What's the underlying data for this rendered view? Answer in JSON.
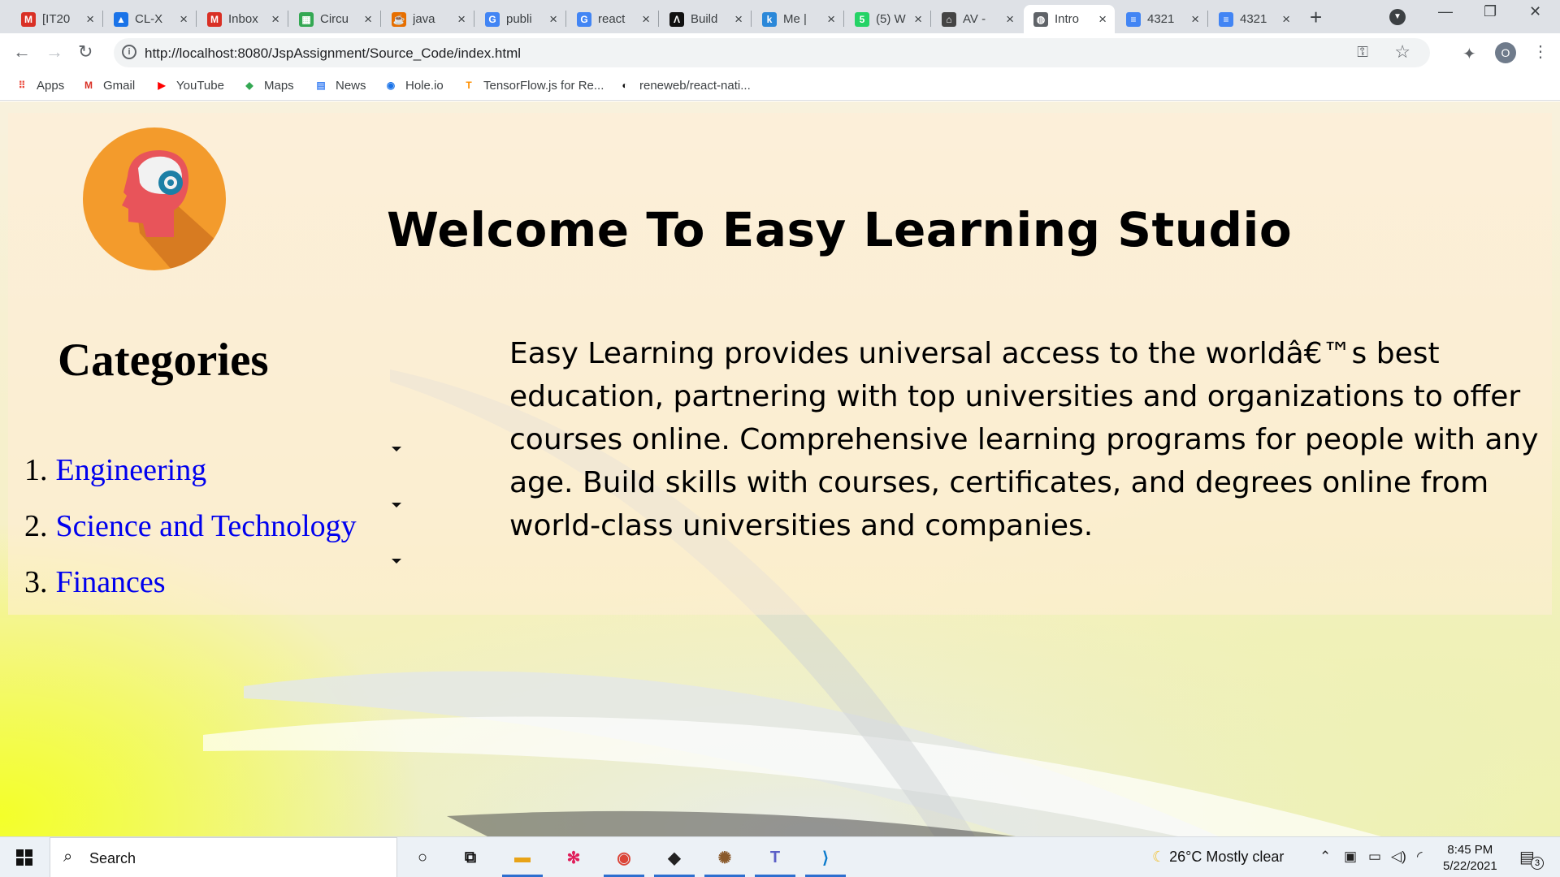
{
  "browser": {
    "tabs": [
      {
        "title": "[IT20",
        "icon": "gmail-icon",
        "color": "#d93025",
        "glyph": "M"
      },
      {
        "title": "CL-X",
        "icon": "drive-icon",
        "color": "#1a73e8",
        "glyph": "▲"
      },
      {
        "title": "Inbox",
        "icon": "gmail-icon",
        "color": "#d93025",
        "glyph": "M"
      },
      {
        "title": "Circu",
        "icon": "grid-icon",
        "color": "#34a853",
        "glyph": "▦"
      },
      {
        "title": "java",
        "icon": "java-icon",
        "color": "#e76f00",
        "glyph": "☕"
      },
      {
        "title": "publi",
        "icon": "google-icon",
        "color": "#4285f4",
        "glyph": "G"
      },
      {
        "title": "react",
        "icon": "google-icon",
        "color": "#4285f4",
        "glyph": "G"
      },
      {
        "title": "Build",
        "icon": "build-icon",
        "color": "#111111",
        "glyph": "Λ"
      },
      {
        "title": "Me |",
        "icon": "k-icon",
        "color": "#2b88d9",
        "glyph": "k"
      },
      {
        "title": "(5) W",
        "icon": "whatsapp-icon",
        "color": "#25d366",
        "glyph": "5"
      },
      {
        "title": "AV -",
        "icon": "academy-icon",
        "color": "#444444",
        "glyph": "⌂"
      },
      {
        "title": "Intro",
        "icon": "globe-icon",
        "color": "#5f6368",
        "glyph": "◍"
      },
      {
        "title": "4321",
        "icon": "docs-icon",
        "color": "#4285f4",
        "glyph": "≡"
      },
      {
        "title": "4321",
        "icon": "docs-icon",
        "color": "#4285f4",
        "glyph": "≡"
      }
    ],
    "url": "http://localhost:8080/JspAssignment/Source_Code/index.html",
    "profile_initial": "O",
    "bookmarks": [
      {
        "label": "Apps",
        "icon": "apps-icon",
        "color": "#ea4335",
        "glyph": "⠿"
      },
      {
        "label": "Gmail",
        "icon": "gmail-icon",
        "color": "#d93025",
        "glyph": "M"
      },
      {
        "label": "YouTube",
        "icon": "youtube-icon",
        "color": "#ff0000",
        "glyph": "▶"
      },
      {
        "label": "Maps",
        "icon": "maps-icon",
        "color": "#34a853",
        "glyph": "◆"
      },
      {
        "label": "News",
        "icon": "news-icon",
        "color": "#4285f4",
        "glyph": "▤"
      },
      {
        "label": "Hole.io",
        "icon": "holeio-icon",
        "color": "#1a73e8",
        "glyph": "◉"
      },
      {
        "label": "TensorFlow.js for Re...",
        "icon": "tensorflow-icon",
        "color": "#ff8f00",
        "glyph": "T"
      },
      {
        "label": "reneweb/react-nati...",
        "icon": "github-icon",
        "color": "#111111",
        "glyph": "◐"
      }
    ]
  },
  "page": {
    "welcome_title": "Welcome To Easy Learning Studio",
    "categories_title": "Categories",
    "categories": [
      {
        "num": "1.",
        "label": "Engineering"
      },
      {
        "num": "2.",
        "label": "Science and Technology"
      },
      {
        "num": "3.",
        "label": "Finances"
      }
    ],
    "description": "Easy Learning provides universal access to the worldâ€™s best education, partnering with top universities and organizations to offer courses online. Comprehensive learning programs for people with any age. Build skills with courses, certificates, and degrees online from world-class universities and companies."
  },
  "taskbar": {
    "search_placeholder": "Search",
    "apps": [
      {
        "name": "cortana-icon",
        "glyph": "○",
        "color": "#111111"
      },
      {
        "name": "task-view-icon",
        "glyph": "⧉",
        "color": "#111111"
      },
      {
        "name": "file-explorer-icon",
        "glyph": "▬",
        "color": "#e8a317"
      },
      {
        "name": "slack-icon",
        "glyph": "✻",
        "color": "#e01e5a"
      },
      {
        "name": "chrome-icon",
        "glyph": "◉",
        "color": "#db4437"
      },
      {
        "name": "predator-icon",
        "glyph": "◆",
        "color": "#222222"
      },
      {
        "name": "game-icon",
        "glyph": "✺",
        "color": "#8a5a2b"
      },
      {
        "name": "teams-icon",
        "glyph": "T",
        "color": "#5b5fc7"
      },
      {
        "name": "vscode-icon",
        "glyph": "⟩",
        "color": "#0a7acc"
      }
    ],
    "weather": "26°C  Mostly clear",
    "time": "8:45 PM",
    "date": "5/22/2021",
    "notification_count": "3"
  }
}
